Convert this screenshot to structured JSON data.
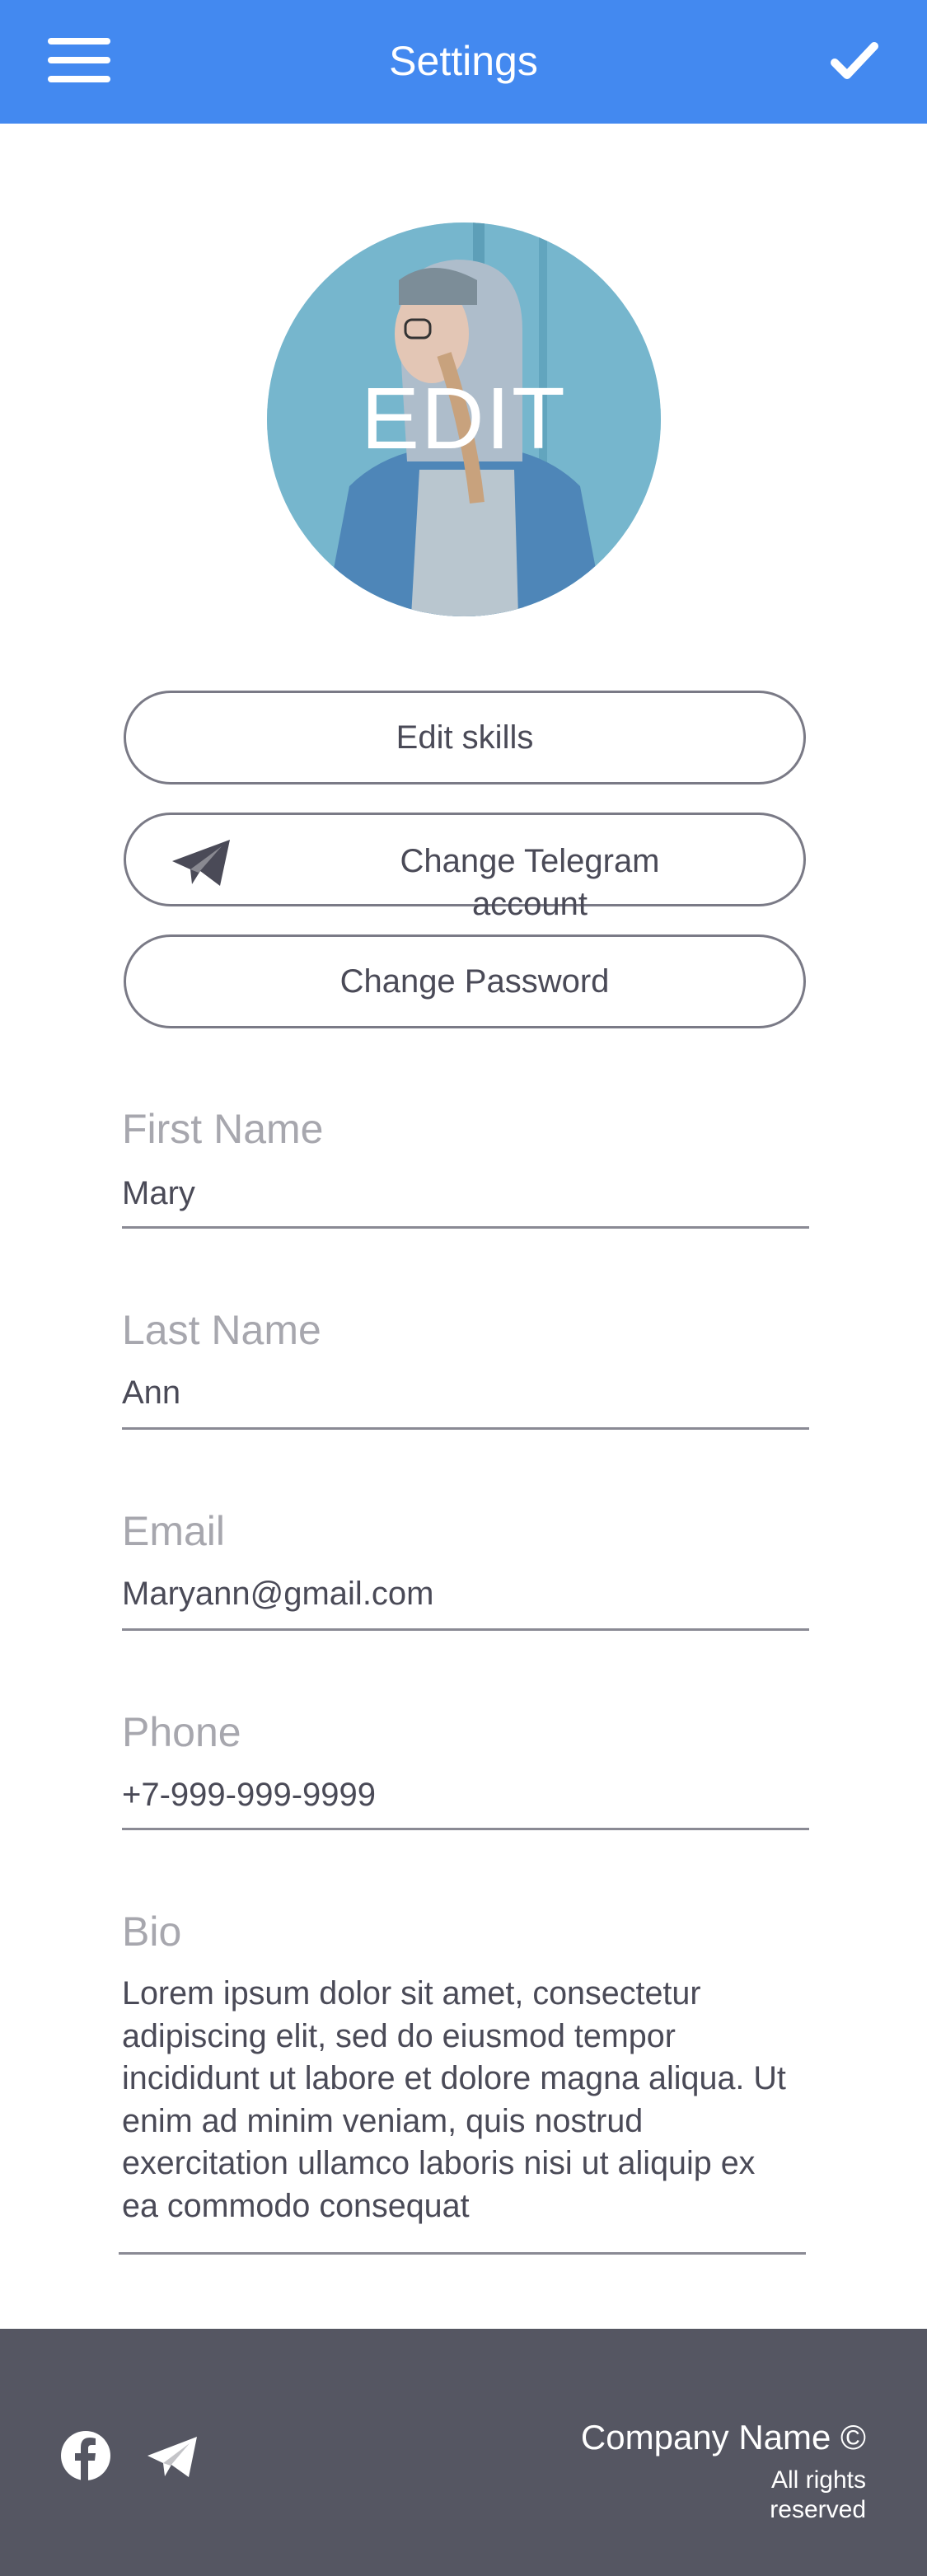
{
  "header": {
    "title": "Settings",
    "menu_icon": "hamburger-menu-icon",
    "confirm_icon": "checkmark-icon",
    "background": "#4389f0"
  },
  "profile": {
    "avatar_overlay_text": "EDIT"
  },
  "actions": [
    {
      "label": "Edit skills"
    },
    {
      "label": "Change Telegram account",
      "icon": "telegram-icon"
    },
    {
      "label": "Change Password"
    }
  ],
  "form": {
    "first_name": {
      "label": "First Name",
      "value": "Mary"
    },
    "last_name": {
      "label": "Last Name",
      "value": "Ann"
    },
    "email": {
      "label": "Email",
      "value": "Maryann@gmail.com"
    },
    "phone": {
      "label": "Phone",
      "value": "+7-999-999-9999"
    },
    "bio": {
      "label": "Bio",
      "value": "Lorem ipsum dolor sit amet, consectetur adipiscing elit, sed do eiusmod tempor incididunt ut labore et dolore magna aliqua. Ut enim ad minim veniam, quis nostrud exercitation ullamco laboris nisi ut aliquip ex ea commodo consequat"
    }
  },
  "footer": {
    "company": "Company Name ©",
    "rights": "All rights reserved",
    "social_icons": [
      "facebook-icon",
      "telegram-icon"
    ],
    "background": "#555662"
  }
}
